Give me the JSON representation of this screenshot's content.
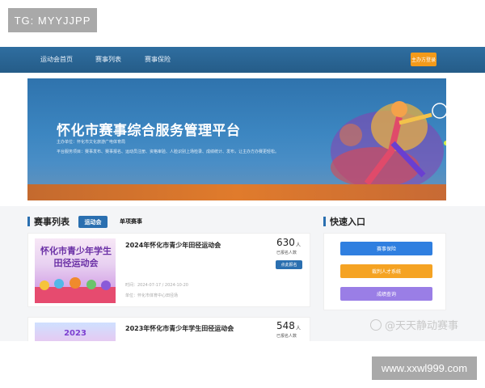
{
  "watermarks": {
    "tg": "TG: MYYJJPP",
    "url": "www.xxwl999.com",
    "mid": "@天天静动赛事"
  },
  "nav": {
    "items": [
      {
        "label": "运动会首页"
      },
      {
        "label": "赛事列表"
      },
      {
        "label": "赛事保险"
      }
    ],
    "login_label": "主办方登录"
  },
  "banner": {
    "title": "怀化市赛事综合服务管理平台",
    "organizer": "主办单位：怀化市文化旅游广电体育局",
    "description": "平台服务项目：赛事发布、赛事报名、运动员注册、资格审验、人脸识别上场检录、成绩统计、发布，让主办方办赛更轻松。"
  },
  "events_section": {
    "title": "赛事列表",
    "tabs": [
      {
        "label": "运动会",
        "active": true
      },
      {
        "label": "单项赛事",
        "active": false
      }
    ],
    "events": [
      {
        "name": "2024年怀化市青少年田径运动会",
        "thumb_text": "怀化市青少年学生田径运动会",
        "count": "630",
        "count_unit": "人",
        "count_label": "已报名人数",
        "signup_label": "点此报名",
        "time": "时间：2024-07-17 / 2024-10-20",
        "org": "单位：怀化市体育中心田径场"
      },
      {
        "name": "2023年怀化市青少年学生田径运动会",
        "thumb_text": "2023",
        "count": "548",
        "count_unit": "人",
        "count_label": "已报名人数"
      }
    ]
  },
  "quick_section": {
    "title": "快速入口",
    "buttons": [
      {
        "label": "赛事保险",
        "color": "#2f7fe0"
      },
      {
        "label": "裁判人才系统",
        "color": "#f5a323"
      },
      {
        "label": "成绩查询",
        "color": "#9a7ee6"
      }
    ]
  },
  "colors": {
    "nav": "#2f6ea0",
    "primary": "#2a6fb0",
    "login": "#f39a1a"
  }
}
